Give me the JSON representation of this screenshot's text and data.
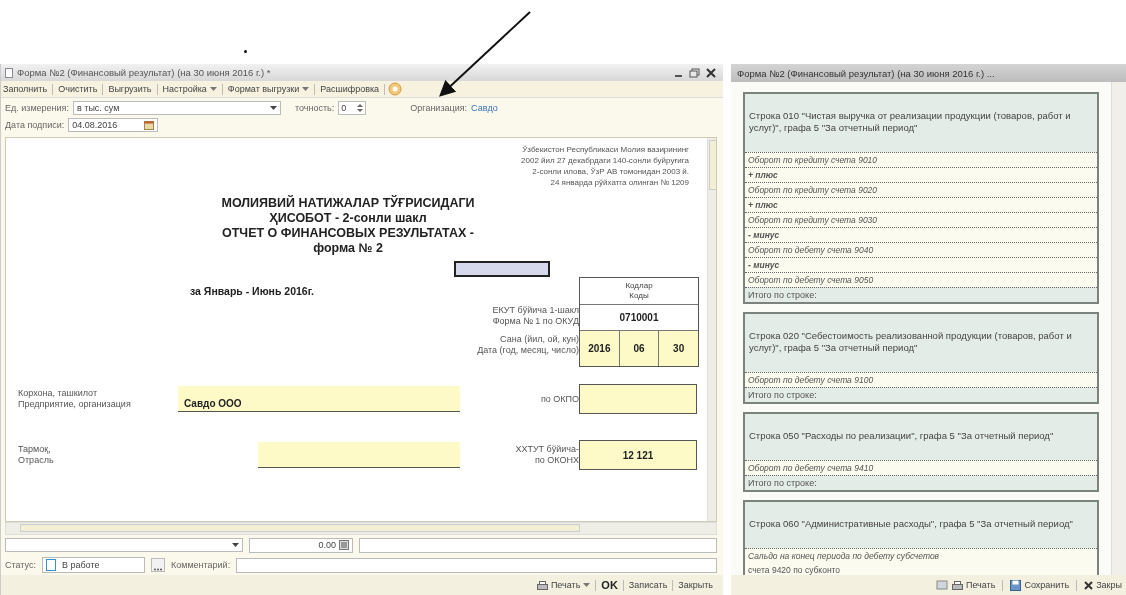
{
  "main_window": {
    "title": "Форма №2 (Финансовый результат) (на 30 июня 2016 г.) *",
    "toolbar": [
      {
        "label": "Заполнить",
        "kind": "button"
      },
      {
        "label": "Очистить",
        "kind": "button"
      },
      {
        "label": "Выгрузить",
        "kind": "button"
      },
      {
        "label": "Настройка",
        "kind": "menu"
      },
      {
        "label": "Формат выгрузки",
        "kind": "menu"
      },
      {
        "label": "Расшифровка",
        "kind": "button"
      },
      {
        "kind": "help"
      }
    ],
    "unit": {
      "label": "Ед. измерения:",
      "value": "в тыс. сум"
    },
    "precision": {
      "label": "точность:",
      "value": "0"
    },
    "organization": {
      "label": "Организация:",
      "value": "Савдо"
    },
    "sign_date": {
      "label": "Дата подписи:",
      "value": "04.08.2016"
    },
    "report": {
      "legal_note": "Ўзбекистон Республикаси Молия вазирининг\n2002 йил 27 декабрдаги 140-сонли буйруғига\n2-сонли илова, ЎзР АВ томонидан 2003 й.\n24 январда рўйхатга олинган № 1209",
      "title": "МОЛИЯВИЙ НАТИЖАЛАР ТЎҒРИСИДАГИ\nҲИСОБОТ - 2-сонли шакл\nОТЧЕТ О ФИНАНСОВЫХ РЕЗУЛЬТАТАХ -\nформа № 2",
      "period": "за Январь - Июнь 2016г.",
      "codes_header": "Кодлар\nКоды",
      "form_label": "ЕКУТ бўйича 1-шакл\nФорма № 1 по ОКУД",
      "form_code": "0710001",
      "date_label": "Сана (йил, ой, кун)\nДата (год, месяц, число)",
      "date_parts": [
        "2016",
        "06",
        "30"
      ],
      "enterprise_label": "Корхона, ташкилот\nПредприятие, организация",
      "enterprise": "Савдо ООО",
      "okpo_label": "по ОКПО",
      "branch_label": "Тармоқ,\nОтрасль",
      "okonh_label": "ХХТУТ бўйича-\nпо ОКОНХ",
      "okonh": "12 121"
    },
    "amount": "0.00",
    "status": {
      "label": "Статус:",
      "value": "В работе"
    },
    "comment": {
      "label": "Комментарий:"
    },
    "footer": [
      {
        "label": "Печать",
        "kind": "menu"
      },
      {
        "label": "OK",
        "kind": "default"
      },
      {
        "label": "Записать",
        "kind": "button"
      },
      {
        "label": "Закрыть",
        "kind": "button"
      }
    ]
  },
  "side_window": {
    "title": "Форма №2 (Финансовый результат) (на 30 июня 2016 г.) ...",
    "cards": [
      {
        "title": "Строка 010 \"Чистая выручка от реализации продукции (товаров, работ и услуг)\", графа 5 \"За отчетный период\"",
        "lines": [
          {
            "text": "Оборот по кредиту счета 9010",
            "kind": "item"
          },
          {
            "text": "+ плюс",
            "kind": "op"
          },
          {
            "text": "Оборот по кредиту счета 9020",
            "kind": "item"
          },
          {
            "text": "+ плюс",
            "kind": "op"
          },
          {
            "text": "Оборот по кредиту счета 9030",
            "kind": "item"
          },
          {
            "text": "- минус",
            "kind": "op"
          },
          {
            "text": "Оборот по дебету счета 9040",
            "kind": "item"
          },
          {
            "text": "- минус",
            "kind": "op"
          },
          {
            "text": "Оборот по дебету счета 9050",
            "kind": "item"
          },
          {
            "text": "Итого по строке:",
            "kind": "total"
          }
        ]
      },
      {
        "title": "Строка 020 \"Себестоимость реализованной продукции (товаров, работ и услуг)\", графа 5 \"За отчетный период\"",
        "lines": [
          {
            "text": "Оборот по дебету счета 9100",
            "kind": "item"
          },
          {
            "text": "Итого по строке:",
            "kind": "total"
          }
        ]
      },
      {
        "title": "Строка 050 \"Расходы по реализации\", графа 5 \"За отчетный период\"",
        "lines": [
          {
            "text": "Оборот по дебету счета 9410",
            "kind": "item"
          },
          {
            "text": "Итого по строке:",
            "kind": "total"
          }
        ]
      },
      {
        "title": "Строка 060 \"Административные расходы\", графа 5 \"За отчетный период\"",
        "lines": [
          {
            "text": "Сальдо на конец периода по дебету субсчетов",
            "kind": "item"
          },
          {
            "text": "счета 9420 по субконто",
            "kind": "plain"
          }
        ]
      }
    ],
    "footer": [
      {
        "label": "Печать",
        "kind": "print"
      },
      {
        "label": "Сохранить",
        "kind": "save"
      },
      {
        "label": "Закры",
        "kind": "close"
      }
    ]
  }
}
